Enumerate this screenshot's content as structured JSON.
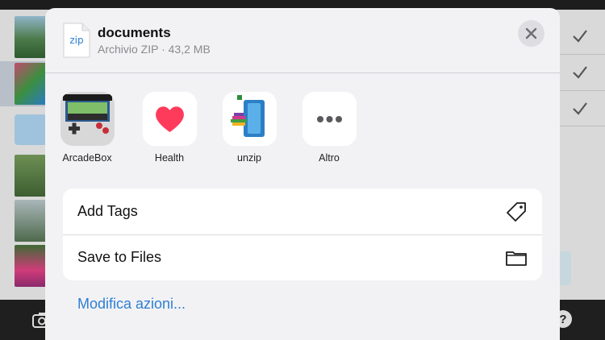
{
  "file": {
    "type_label": "zip",
    "name": "documents",
    "meta": "Archivio ZIP · 43,2 MB"
  },
  "apps": [
    {
      "label": "ArcadeBox",
      "icon": "arcadebox-app-icon"
    },
    {
      "label": "Health",
      "icon": "health-app-icon"
    },
    {
      "label": "unzip",
      "icon": "unzip-app-icon"
    },
    {
      "label": "Altro",
      "icon": "more-icon"
    }
  ],
  "actions": [
    {
      "label": "Add Tags",
      "icon": "tag-icon"
    },
    {
      "label": "Save to Files",
      "icon": "folder-icon"
    }
  ],
  "edit_actions_label": "Modifica azioni...",
  "colors": {
    "accent": "#2f7fd3",
    "sheet_bg": "#f2f2f4",
    "health_heart": "#ff3b5c"
  }
}
